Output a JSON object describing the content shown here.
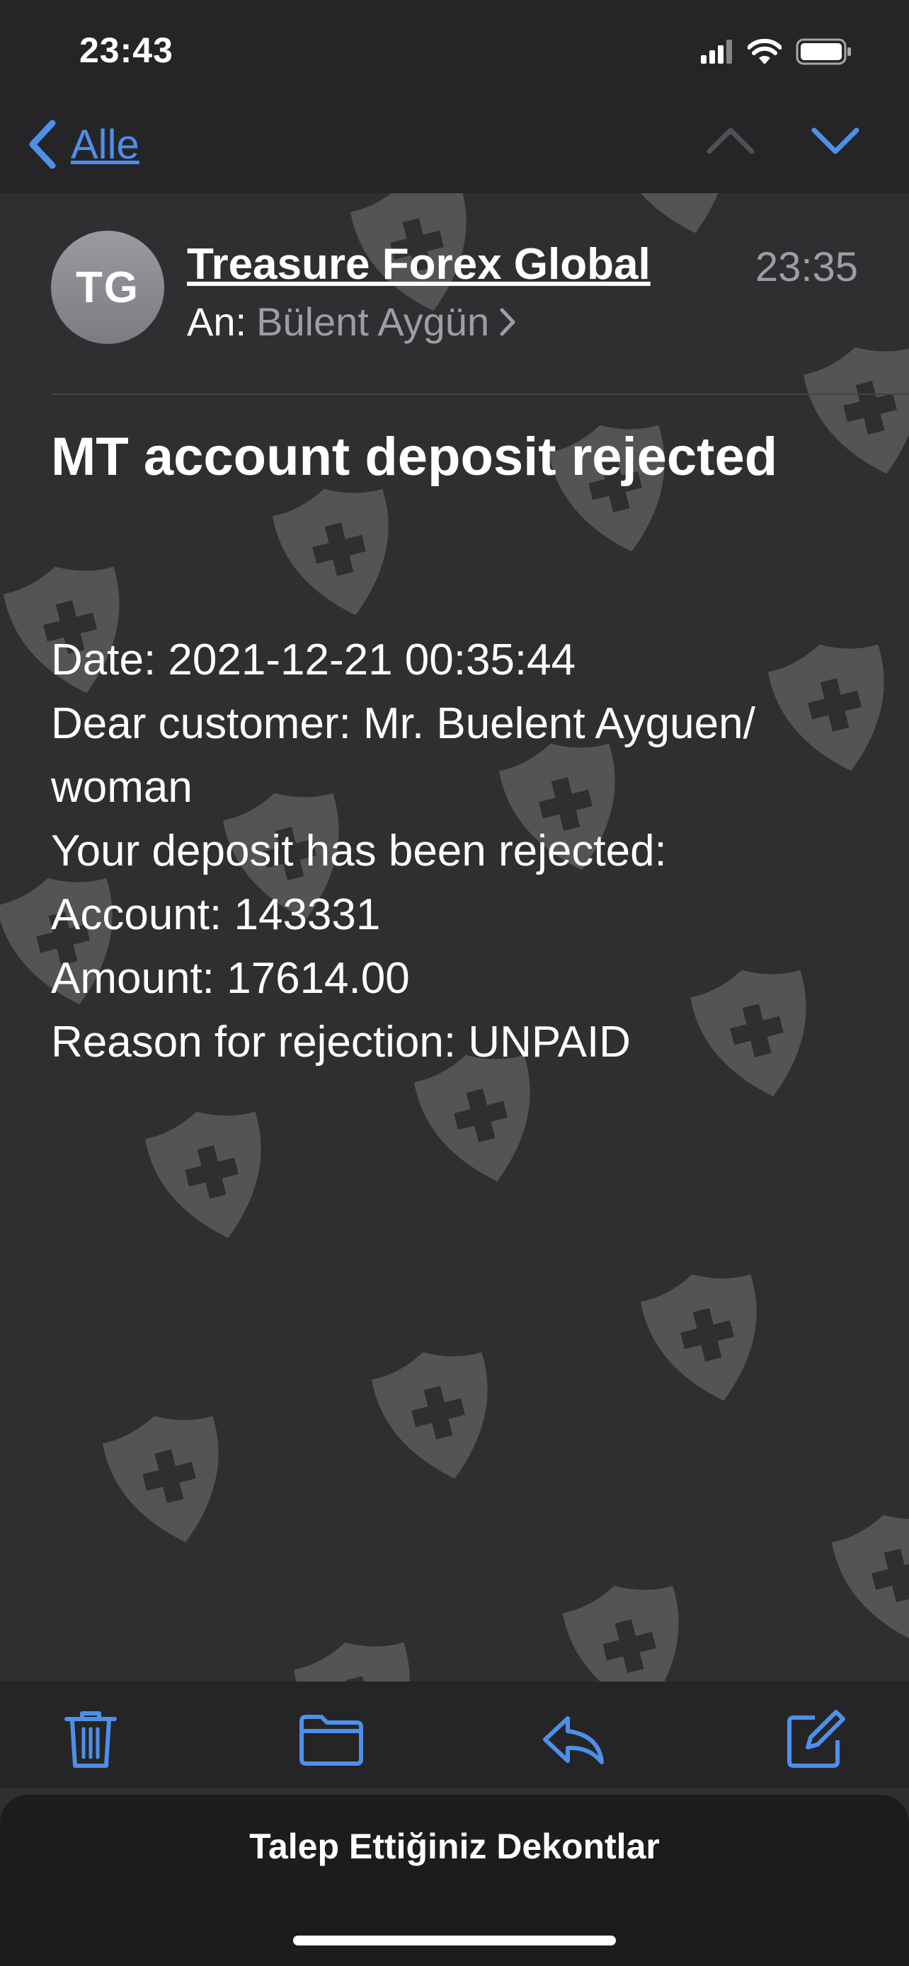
{
  "status_bar": {
    "time": "23:43"
  },
  "nav": {
    "back_label": "Alle"
  },
  "message": {
    "avatar_initials": "TG",
    "sender": "Treasure Forex Global",
    "time": "23:35",
    "to_label": "An:",
    "to_name": "Bülent Aygün",
    "subject": "MT account deposit rejected",
    "body_lines": [
      "Date: 2021-12-21 00:35:44",
      "Dear customer: Mr. Buelent Ayguen/",
      "woman",
      "Your deposit has been rejected:",
      "Account: 143331",
      "Amount: 17614.00",
      "Reason for rejection: UNPAID"
    ]
  },
  "toolbar": {
    "items": [
      {
        "icon": "trash-icon"
      },
      {
        "icon": "folder-icon"
      },
      {
        "icon": "reply-icon"
      },
      {
        "icon": "compose-icon"
      }
    ]
  },
  "sheet": {
    "title": "Talep Ettiğiniz Dekontlar"
  },
  "colors": {
    "accent": "#4e8fea",
    "background": "#2f2f31",
    "bars": "#252527",
    "secondary_text": "#9d9da3"
  }
}
